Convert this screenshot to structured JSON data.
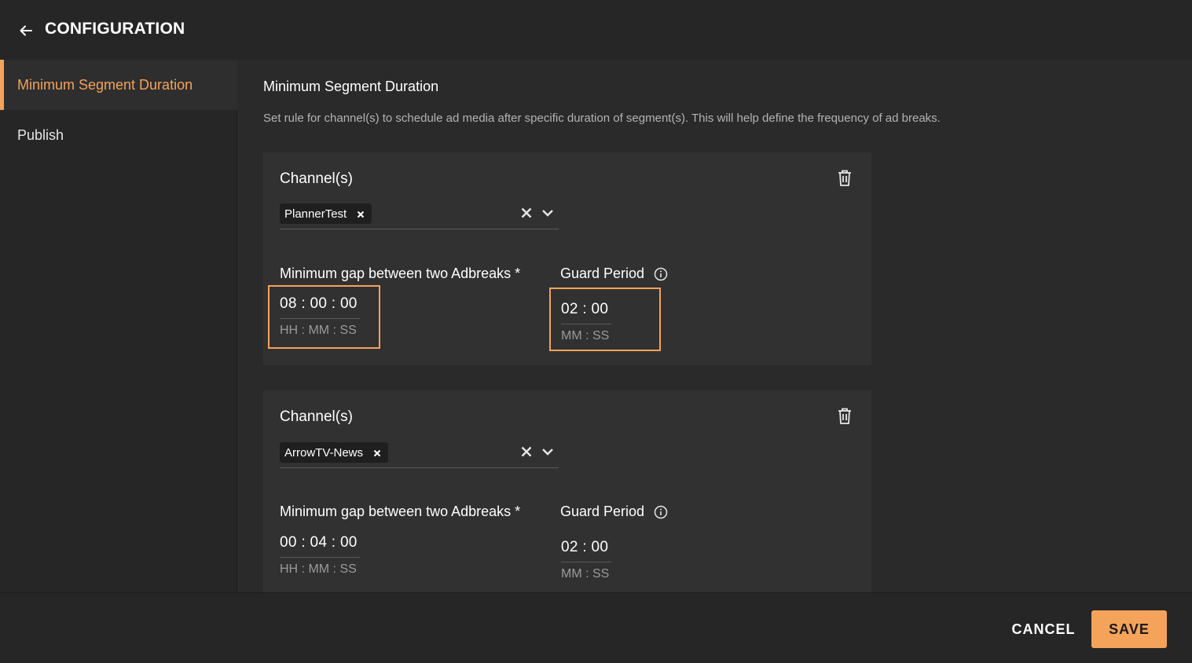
{
  "header": {
    "title": "CONFIGURATION",
    "back_icon": "arrow-left-icon"
  },
  "sidebar": {
    "items": [
      {
        "label": "Minimum Segment Duration",
        "active": true
      },
      {
        "label": "Publish",
        "active": false
      }
    ]
  },
  "main": {
    "title": "Minimum Segment Duration",
    "description": "Set rule for channel(s) to schedule ad media after specific duration of segment(s). This will help define the frequency of ad breaks.",
    "rules": [
      {
        "channels_label": "Channel(s)",
        "channels": [
          "PlannerTest"
        ],
        "min_gap_label": "Minimum gap between two Adbreaks *",
        "min_gap_value": "08 : 00 : 00",
        "min_gap_format": "HH : MM : SS",
        "guard_label": "Guard Period",
        "guard_value": "02 : 00",
        "guard_format": "MM : SS"
      },
      {
        "channels_label": "Channel(s)",
        "channels": [
          "ArrowTV-News"
        ],
        "min_gap_label": "Minimum gap between two Adbreaks *",
        "min_gap_value": "00 : 04 : 00",
        "min_gap_format": "HH : MM : SS",
        "guard_label": "Guard Period",
        "guard_value": "02 : 00",
        "guard_format": "MM : SS"
      }
    ]
  },
  "footer": {
    "cancel_label": "CANCEL",
    "save_label": "SAVE"
  },
  "colors": {
    "accent": "#f5a35a",
    "background": "#262626",
    "panel": "#2a2a2a",
    "card": "#313131"
  }
}
